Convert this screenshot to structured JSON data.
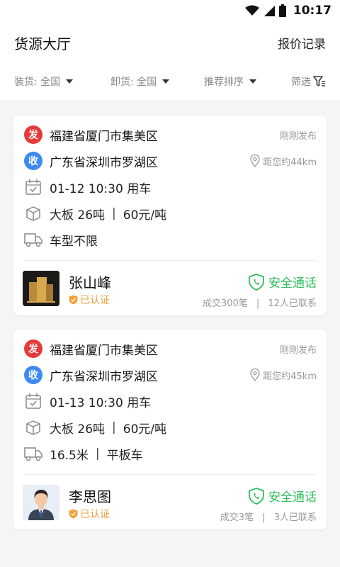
{
  "status_bar": {
    "time": "10:17"
  },
  "header": {
    "title": "货源大厅",
    "quote_records": "报价记录"
  },
  "filters": {
    "loading": "装货: 全国",
    "unloading": "卸货: 全国",
    "sort": "推荐排序",
    "filter": "筛选"
  },
  "cards": [
    {
      "from_badge": "发",
      "from": "福建省厦门市集美区",
      "posted": "刚刚发布",
      "to_badge": "收",
      "to": "广东省深圳市罗湖区",
      "distance": "距您约44km",
      "time": "01-12 10:30 用车",
      "goods": "大板 26吨",
      "price": "60元/吨",
      "vehicle": "车型不限",
      "vehicle_extra": "",
      "user": "张山峰",
      "verified": "已认证",
      "call": "安全通话",
      "deals": "成交300笔",
      "contacts": "12人已联系"
    },
    {
      "from_badge": "发",
      "from": "福建省厦门市集美区",
      "posted": "刚刚发布",
      "to_badge": "收",
      "to": "广东省深圳市罗湖区",
      "distance": "距您约45km",
      "time": "01-13 10:30 用车",
      "goods": "大板 26吨",
      "price": "60元/吨",
      "vehicle": "16.5米",
      "vehicle_extra": "平板车",
      "user": "李思图",
      "verified": "已认证",
      "call": "安全通话",
      "deals": "成交3笔",
      "contacts": "3人已联系"
    }
  ],
  "colors": {
    "from_badge": "#e63a3a",
    "to_badge": "#3d8bf2",
    "call": "#2fbf5a",
    "verified": "#f1a23a"
  }
}
